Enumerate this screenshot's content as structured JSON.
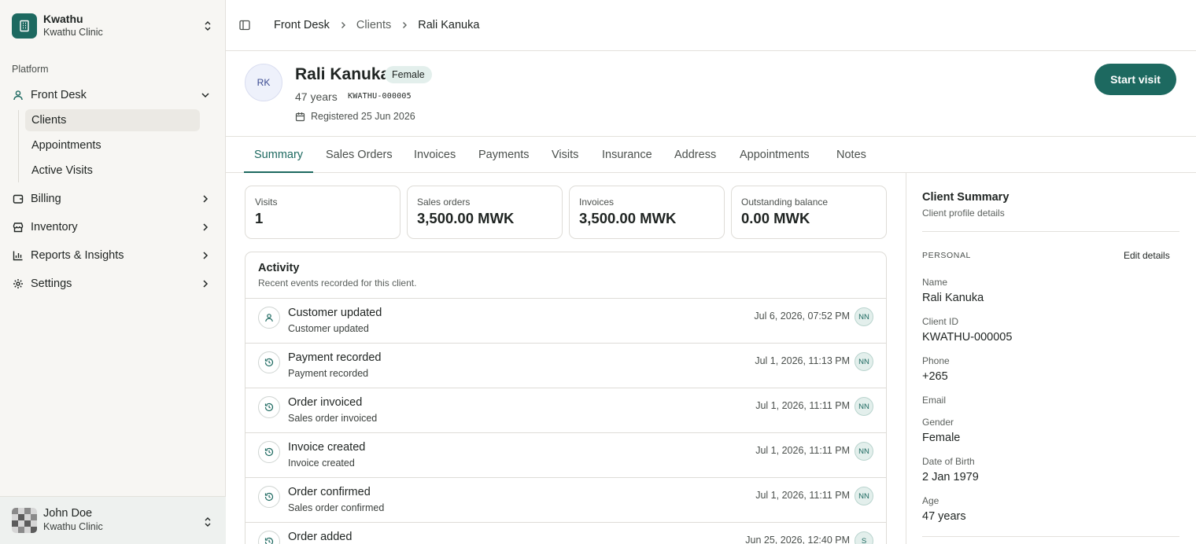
{
  "org": {
    "name": "Kwathu",
    "clinic": "Kwathu Clinic"
  },
  "sidebar": {
    "section_label": "Platform",
    "front_desk": "Front Desk",
    "sub_items": [
      "Clients",
      "Appointments",
      "Active Visits"
    ],
    "billing": "Billing",
    "inventory": "Inventory",
    "reports": "Reports & Insights",
    "settings": "Settings"
  },
  "user": {
    "name": "John Doe",
    "clinic": "Kwathu Clinic"
  },
  "breadcrumb": [
    "Front Desk",
    "Clients",
    "Rali Kanuka"
  ],
  "client": {
    "initials": "RK",
    "name": "Rali Kanuka",
    "gender_badge": "Female",
    "age": "47 years",
    "client_id": "KWATHU-000005",
    "registered": "Registered 25 Jun 2026"
  },
  "start_visit_label": "Start visit",
  "tabs": [
    "Summary",
    "Sales Orders",
    "Invoices",
    "Payments",
    "Visits",
    "Insurance",
    "Address",
    "Appointments",
    "Notes"
  ],
  "active_tab": "Summary",
  "stats": [
    {
      "label": "Visits",
      "value": "1"
    },
    {
      "label": "Sales orders",
      "value": "3,500.00 MWK"
    },
    {
      "label": "Invoices",
      "value": "3,500.00 MWK"
    },
    {
      "label": "Outstanding balance",
      "value": "0.00 MWK"
    }
  ],
  "activity": {
    "title": "Activity",
    "subtitle": "Recent events recorded for this client.",
    "items": [
      {
        "icon": "user-icon",
        "title": "Customer updated",
        "desc": "Customer updated",
        "time": "Jul 6, 2026, 07:52 PM",
        "who": "NN"
      },
      {
        "icon": "history-icon",
        "title": "Payment recorded",
        "desc": "Payment recorded",
        "time": "Jul 1, 2026, 11:13 PM",
        "who": "NN"
      },
      {
        "icon": "history-icon",
        "title": "Order invoiced",
        "desc": "Sales order invoiced",
        "time": "Jul 1, 2026, 11:11 PM",
        "who": "NN"
      },
      {
        "icon": "history-icon",
        "title": "Invoice created",
        "desc": "Invoice created",
        "time": "Jul 1, 2026, 11:11 PM",
        "who": "NN"
      },
      {
        "icon": "history-icon",
        "title": "Order confirmed",
        "desc": "Sales order confirmed",
        "time": "Jul 1, 2026, 11:11 PM",
        "who": "NN"
      },
      {
        "icon": "history-icon",
        "title": "Order added",
        "desc": "",
        "time": "Jun 25, 2026, 12:40 PM",
        "who": "S"
      }
    ]
  },
  "summary_panel": {
    "title": "Client Summary",
    "subtitle": "Client profile details",
    "section": "PERSONAL",
    "edit_label": "Edit details",
    "fields": [
      {
        "label": "Name",
        "value": "Rali Kanuka"
      },
      {
        "label": "Client ID",
        "value": "KWATHU-000005"
      },
      {
        "label": "Phone",
        "value": "+265"
      },
      {
        "label": "Email",
        "value": ""
      },
      {
        "label": "Gender",
        "value": "Female"
      },
      {
        "label": "Date of Birth",
        "value": "2 Jan 1979"
      },
      {
        "label": "Age",
        "value": "47 years"
      }
    ]
  },
  "colors": {
    "brand": "#1d6960",
    "sidebar_bg": "#f7f6f3",
    "badge_bg": "#e3efec"
  }
}
